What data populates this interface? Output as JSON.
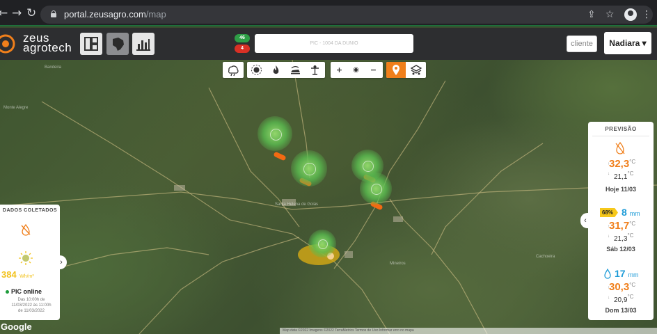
{
  "browser": {
    "url_host": "portal.zeusagro.com",
    "url_path": "/map",
    "back_glyph": "←",
    "forward_glyph": "→",
    "reload_glyph": "↻",
    "share_glyph": "⇪",
    "star_glyph": "☆",
    "menu_glyph": "⋮"
  },
  "header": {
    "logo_line1": "zeus",
    "logo_line2": "agrotech",
    "brand_color": "#f07f1b",
    "view_buttons": [
      "dashboard-icon",
      "brazil-map-icon",
      "bar-chart-icon"
    ],
    "badge_top": "46",
    "badge_bottom": "4",
    "field_select": "PIC - 1004 DA DUNIO",
    "cliente_label": "cliente",
    "user_label": "Nadiara",
    "user_caret": "▾"
  },
  "map_tools": {
    "rain_icon": "cloud-rain-icon",
    "group2": [
      "sun-icon",
      "fire-icon",
      "tractor-icon",
      "station-icon"
    ],
    "zoom_in": "+",
    "center": "◉",
    "zoom_out": "−",
    "pin_icon": "map-pin-icon",
    "layers_icon": "layers-icon"
  },
  "map": {
    "labels": [
      "Bandeira",
      "Monte Alegre",
      "Santa Helena de Goiás",
      "Mineiros",
      "Cachoeira"
    ]
  },
  "left_panel": {
    "title": "DADOS COLETADOS",
    "radiation_value": "384",
    "radiation_unit": "Wh/m²",
    "status": "PIC online",
    "detail_lines": [
      "Das 10:00h de",
      "11/03/2022 às 11:00h",
      "de 11/03/2022"
    ],
    "expand_glyph": "›"
  },
  "right_panel": {
    "title": "PREVISÃO",
    "collapse_glyph": "‹",
    "days": [
      {
        "tmax": "32,3",
        "tmin": "21,1",
        "unit": "°C",
        "date": "Hoje 11/03"
      },
      {
        "prob": "68%",
        "rain": "8",
        "rain_unit": "mm",
        "tmax": "31,7",
        "tmin": "21,3",
        "unit": "°C",
        "date": "Sáb 12/03"
      },
      {
        "rain": "17",
        "rain_unit": "mm",
        "tmax": "30,3",
        "tmin": "20,9",
        "unit": "°C",
        "date": "Dom 13/03"
      }
    ]
  },
  "google_logo": "Google",
  "attribution": "Map data ©2022 Imagens ©2022 TerraMetrics  Termos de Uso  Informar erro no mapa"
}
